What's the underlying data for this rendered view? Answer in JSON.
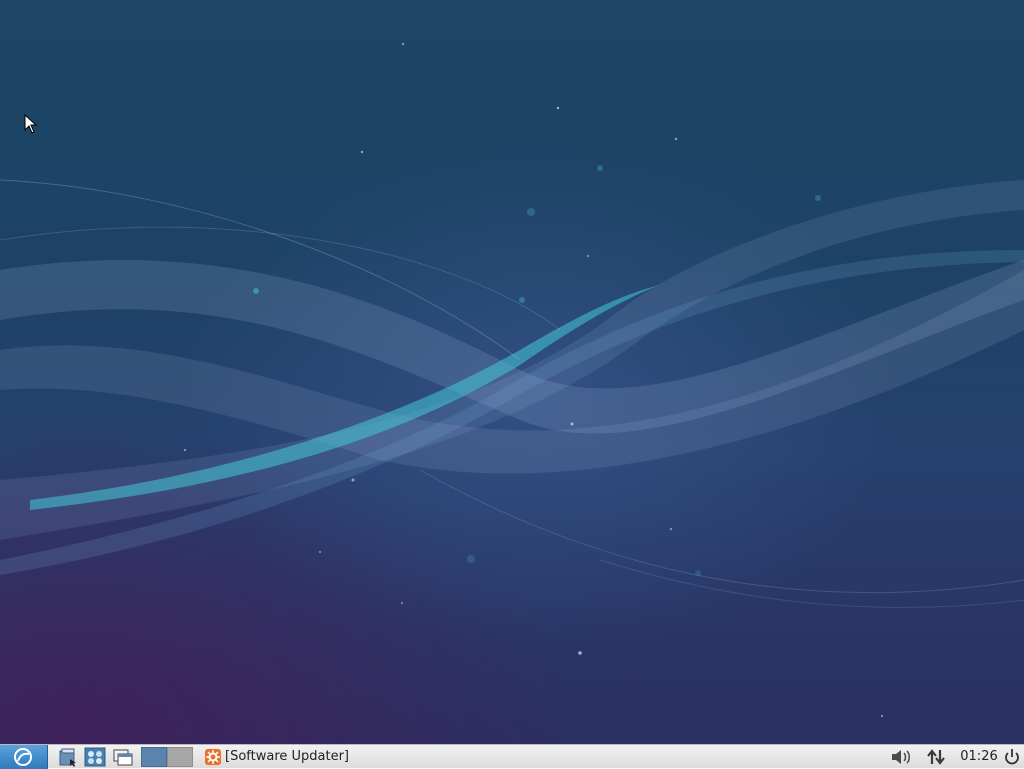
{
  "desktop": {
    "wallpaper_icon": "lubuntu-wave-wallpaper",
    "cursor_icon": "mouse-pointer-icon"
  },
  "taskbar": {
    "menu_icon": "lubuntu-logo-icon",
    "launchers": [
      {
        "icon": "file-manager-icon"
      },
      {
        "icon": "network-manager-icon"
      },
      {
        "icon": "show-desktop-icon"
      }
    ],
    "workspaces": [
      {
        "active": true
      },
      {
        "active": false
      }
    ],
    "tasks": [
      {
        "label": "[Software Updater]",
        "icon": "software-updater-icon"
      }
    ],
    "tray": {
      "volume_icon": "volume-icon",
      "network_icon": "network-arrows-icon",
      "clock": "01:26",
      "power_icon": "power-icon"
    },
    "colors": {
      "accent": "#2f79bd",
      "panel": "#e6e6e6",
      "workspace_active": "#5a84ad",
      "workspace_inactive": "#a7a7a7"
    }
  }
}
